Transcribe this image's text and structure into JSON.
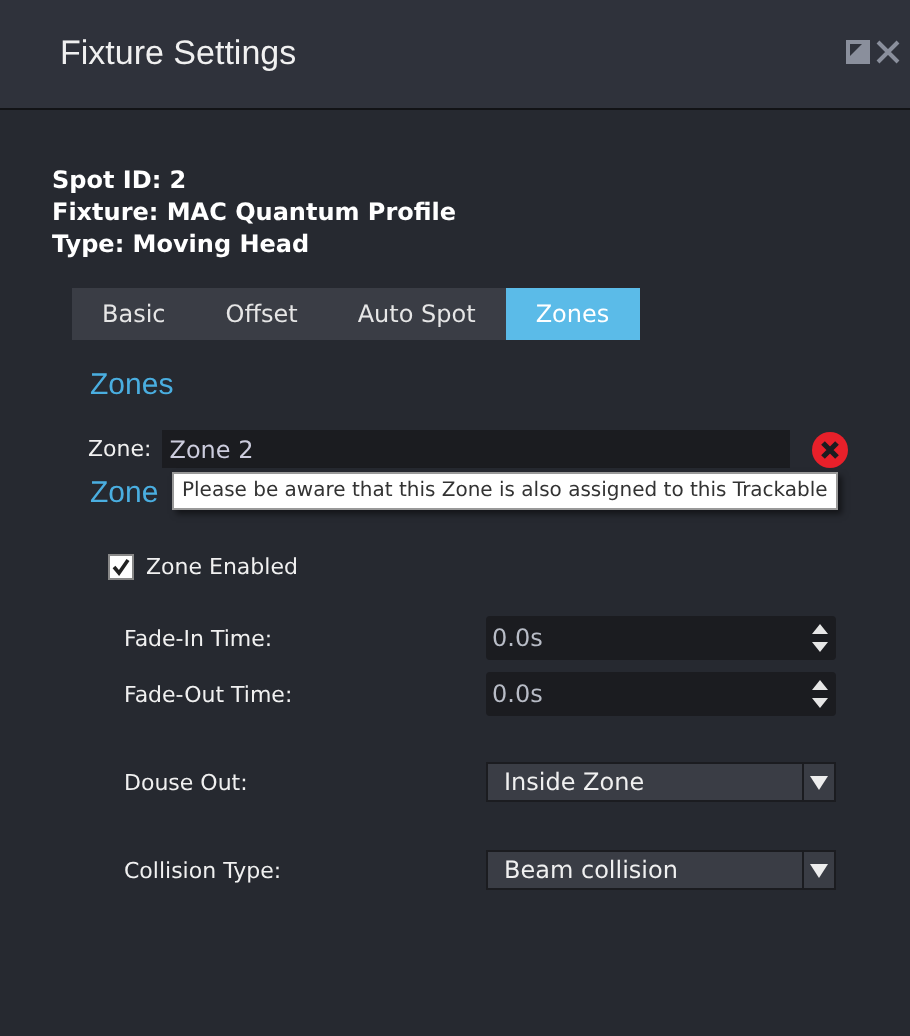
{
  "window": {
    "title": "Fixture Settings"
  },
  "info": [
    "Spot ID: 2",
    "Fixture: MAC Quantum Profile",
    "Type: Moving Head"
  ],
  "tabs": [
    {
      "label": "Basic",
      "selected": false
    },
    {
      "label": "Offset",
      "selected": false
    },
    {
      "label": "Auto Spot",
      "selected": false
    },
    {
      "label": "Zones",
      "selected": true
    }
  ],
  "zones": {
    "heading": "Zones",
    "zone_label": "Zone:",
    "zone_value": "Zone 2",
    "tooltip": "Please be aware that this Zone is also assigned to this Trackable"
  },
  "zone_settings": {
    "heading": "Zone",
    "enabled": {
      "label": "Zone Enabled",
      "checked": true
    },
    "fields": [
      {
        "kind": "spin",
        "label": "Fade-In Time:",
        "value": "0.0s"
      },
      {
        "kind": "spin",
        "label": "Fade-Out Time:",
        "value": "0.0s"
      },
      {
        "kind": "select",
        "label": "Douse Out:",
        "value": "Inside Zone"
      },
      {
        "kind": "select",
        "label": "Collision Type:",
        "value": "Beam collision"
      }
    ]
  }
}
